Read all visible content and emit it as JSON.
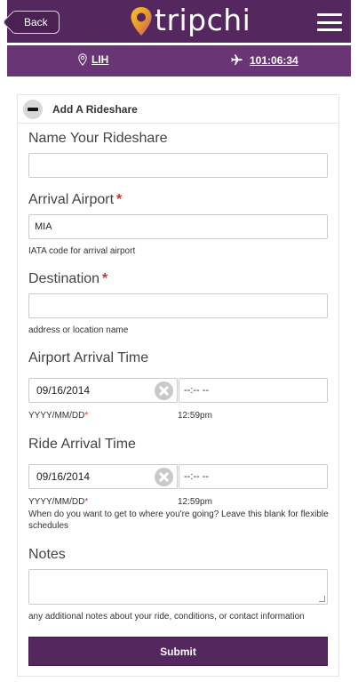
{
  "header": {
    "back_label": "Back",
    "logo_text": "tripchi",
    "brand_color": "#55275f",
    "icons": [
      "location-pin-icon",
      "menu-icon"
    ]
  },
  "subbar": {
    "location": "LIH",
    "flight_time": "101:06:34",
    "icons": [
      "map-pin-icon",
      "airplane-icon"
    ]
  },
  "form": {
    "title": "Add A Rideshare",
    "name": {
      "label": "Name Your Rideshare",
      "value": ""
    },
    "arrival_airport": {
      "label": "Arrival Airport",
      "required": "*",
      "value": "MIA",
      "help": "IATA code for arrival airport"
    },
    "destination": {
      "label": "Destination",
      "required": "*",
      "value": "",
      "help": "address or location name"
    },
    "airport_arrival_time": {
      "label": "Airport Arrival Time",
      "date_value": "09/16/2014",
      "time_value": "--:-- --",
      "date_format": "YYYY/MM/DD",
      "date_required": "*",
      "time_format": "12:59pm"
    },
    "ride_arrival_time": {
      "label": "Ride Arrival Time",
      "date_value": "09/16/2014",
      "time_value": "--:-- --",
      "date_format": "YYYY/MM/DD",
      "date_required": "*",
      "time_format": "12:59pm",
      "help": "When do you want to get to where you're going? Leave this blank for flexible schedules"
    },
    "notes": {
      "label": "Notes",
      "value": "",
      "help": "any additional notes about your ride, conditions, or contact information"
    },
    "submit_label": "Submit"
  }
}
